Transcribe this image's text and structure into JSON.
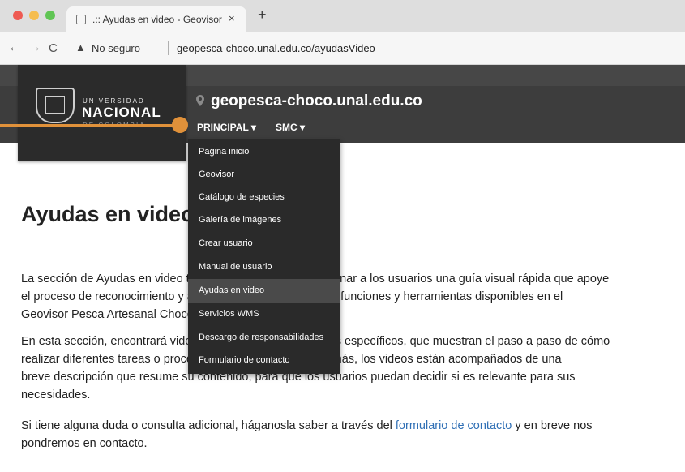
{
  "browser": {
    "tab_title": ".:: Ayudas en video - Geovisor",
    "close_glyph": "×",
    "new_tab_glyph": "+",
    "not_secure": "No seguro",
    "url": "geopesca-choco.unal.edu.co/ayudasVideo"
  },
  "header": {
    "univ_small": "UNIVERSIDAD",
    "univ_big": "NACIONAL",
    "univ_country": "DE COLOMBIA",
    "site_title": "geopesca-choco.unal.edu.co",
    "menu": [
      {
        "label": "PRINCIPAL ▾"
      },
      {
        "label": "SMC ▾"
      }
    ]
  },
  "dropdown": {
    "items": [
      {
        "label": "Pagina inicio"
      },
      {
        "label": "Geovisor"
      },
      {
        "label": "Catálogo de especies"
      },
      {
        "label": "Galería de imágenes"
      },
      {
        "label": "Crear usuario"
      },
      {
        "label": "Manual de usuario"
      },
      {
        "label": "Ayudas en video",
        "active": true
      },
      {
        "label": "Servicios WMS"
      },
      {
        "label": "Descargo de responsabilidades"
      },
      {
        "label": "Formulario de contacto"
      }
    ]
  },
  "content": {
    "heading": "Ayudas en video",
    "p1_line1": "La sección de Ayudas en video tiene como objetivo proporcionar a los usuarios una guía visual rápida que apoye",
    "p1_line2": "el proceso de reconocimiento y aprendizaje de las diferentes funciones y herramientas disponibles en el",
    "p1_line3": "Geovisor Pesca Artesanal Chocó.",
    "p2_line1": "En esta sección, encontrará videos relacionados con a temas específicos, que muestran el paso a paso de cómo",
    "p2_line2": "realizar diferentes tareas o procedimientos específicos. Además, los videos están acompañados de una",
    "p2_line3": "breve descripción que resume su contenido, para que los usuarios puedan decidir si es relevante para sus",
    "p2_line4": "necesidades.",
    "p3_before": "Si tiene alguna duda o consulta adicional, háganosla saber a través del ",
    "p3_link": "formulario de contacto",
    "p3_after": " y en breve nos",
    "p3_line2": "pondremos en contacto."
  }
}
